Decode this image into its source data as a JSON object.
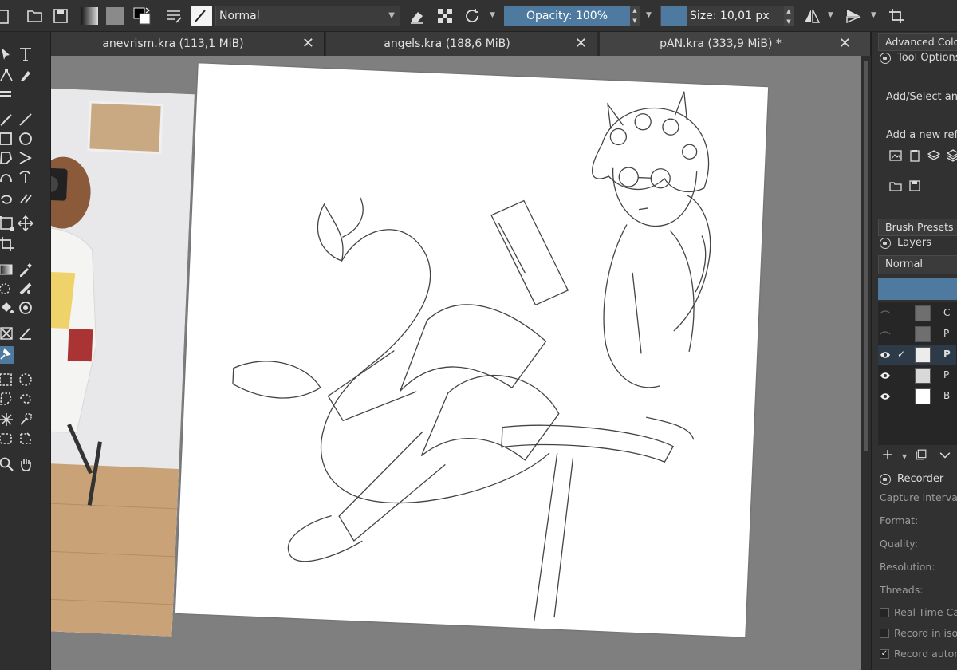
{
  "colors": {
    "accent": "#4f7aa0",
    "canvas_bg": "#7f7f7f",
    "panel": "#313131"
  },
  "toolbar": {
    "blend_mode": "Normal",
    "opacity_label": "Opacity: 100%",
    "opacity_value": 1.0,
    "size_label": "Size: 10,01 px",
    "icons": [
      "new-document-icon",
      "open-folder-icon",
      "save-icon",
      "gradient-swatch-icon",
      "pattern-swatch-icon",
      "color-swap-icon",
      "brush-settings-icon",
      "brush-preset-icon",
      "eraser-icon",
      "alpha-lock-icon",
      "reload-brush-icon",
      "mirror-horizontal-icon",
      "mirror-vertical-icon",
      "wrap-around-icon"
    ]
  },
  "tabs": [
    {
      "label": "anevrism.kra (113,1 MiB)",
      "close": "✕"
    },
    {
      "label": "angels.kra (188,6 MiB)",
      "close": "✕"
    },
    {
      "label": "pAN.kra (333,9 MiB) *",
      "close": "✕"
    }
  ],
  "toolbox": {
    "tools": [
      "select-shapes-icon",
      "text-tool-icon",
      "edit-shapes-icon",
      "calligraphy-icon",
      "crop-bars-icon",
      "freehand-brush-icon",
      "line-tool-icon",
      "rectangle-tool-icon",
      "ellipse-tool-icon",
      "polygon-tool-icon",
      "polyline-tool-icon",
      "bezier-tool-icon",
      "freehand-path-icon",
      "dynamic-brush-icon",
      "multibrush-icon",
      "transform-tool-icon",
      "move-tool-icon",
      "crop-tool-icon",
      "gradient-tool-icon",
      "color-picker-icon",
      "colorize-mask-icon",
      "smart-patch-icon",
      "fill-tool-icon",
      "enclose-fill-icon",
      "assistant-tool-icon",
      "measure-tool-icon",
      "reference-images-tool-icon",
      "rect-select-icon",
      "ellipse-select-icon",
      "polygon-select-icon",
      "freehand-select-icon",
      "contiguous-select-icon",
      "similar-select-icon",
      "bezier-select-icon",
      "magnetic-select-icon",
      "zoom-tool-icon",
      "pan-tool-icon"
    ]
  },
  "docker": {
    "advanced_color_tab": "Advanced Color",
    "tool_options_title": "Tool Options",
    "add_select_text": "Add/Select an in",
    "add_new_reference_text": "Add a new refere",
    "brush_presets_tab": "Brush Presets",
    "layers_title": "Layers",
    "layers_blend_mode": "Normal",
    "layers": [
      {
        "name": "C",
        "visible": false,
        "checked": false,
        "selected": false,
        "thumb": "gray"
      },
      {
        "name": "P",
        "visible": false,
        "checked": false,
        "selected": false,
        "thumb": "gray"
      },
      {
        "name": "P",
        "visible": true,
        "checked": true,
        "selected": true,
        "thumb": "transparent"
      },
      {
        "name": "P",
        "visible": true,
        "checked": false,
        "selected": false,
        "thumb": "transparent"
      },
      {
        "name": "B",
        "visible": true,
        "checked": false,
        "selected": false,
        "thumb": "white"
      }
    ],
    "recorder_title": "Recorder",
    "recorder_fields": [
      "Capture interval:",
      "Format:",
      "Quality:",
      "Resolution:",
      "Threads:"
    ],
    "recorder_options": [
      {
        "label": "Real Time Capt",
        "checked": false
      },
      {
        "label": "Record in isola",
        "checked": false
      },
      {
        "label": "Record autom",
        "checked": true
      }
    ]
  }
}
